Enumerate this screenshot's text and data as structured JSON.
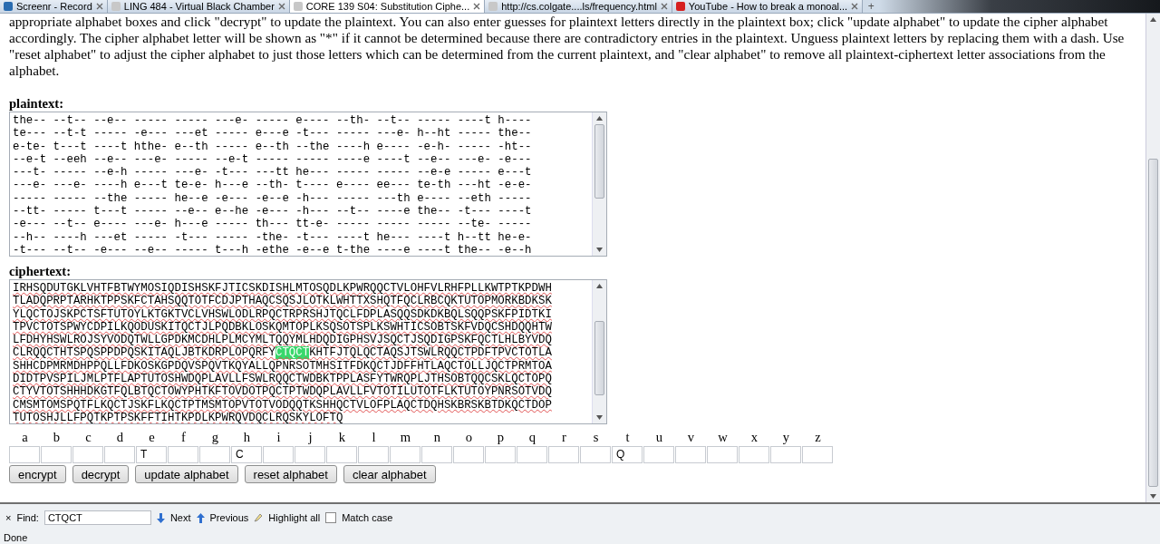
{
  "tabs": [
    {
      "title": "Screenr - Record",
      "selected": false
    },
    {
      "title": "LING 484 - Virtual Black Chamber",
      "selected": false
    },
    {
      "title": "CORE 139 S04: Substitution Ciphe...",
      "selected": true
    },
    {
      "title": "http://cs.colgate....ls/frequency.html",
      "selected": false
    },
    {
      "title": "YouTube - How to break a monoal...",
      "selected": false
    }
  ],
  "new_tab": "+",
  "instructions": "appropriate alphabet boxes and click \"decrypt\" to update the plaintext. You can also enter guesses for plaintext letters directly in the plaintext box; click \"update alphabet\" to update the cipher alphabet accordingly. The cipher alphabet letter will be shown as \"*\" if it cannot be determined because there are contradictory entries in the plaintext. Unguess plaintext letters by replacing them with a dash. Use \"reset alphabet\" to adjust the cipher alphabet to just those letters which can be determined from the current plaintext, and \"clear alphabet\" to remove all plaintext-ciphertext letter associations from the alphabet.",
  "plaintext": {
    "label": "plaintext:",
    "lines": [
      "the-- --t-- --e-- ----- ----- ---e- ----- e---- --th- --t-- ----- ----t h----",
      "te--- --t-t ----- -e--- ---et ----- e---e -t--- ----- ---e- h--ht ----- the--",
      "e-te- t---t ----t hthe- e--th ----- e--th --the ----h e---- -e-h- ----- -ht--",
      "--e-t --eeh --e-- ---e- ----- --e-t ----- ----- ----e ----t --e-- ---e- -e---",
      "---t- ----- --e-h ----- ---e- -t--- ---tt he--- ----- ----- --e-e ----- e---t",
      "---e- ---e- ----h e---t te-e- h---e --th- t---- e---- ee--- te-th ---ht -e-e-",
      "----- ----- --the ----- he--e -e--- -e--e -h--- ----- ---th e---- --eth -----",
      "--tt- ----- t---t ----- --e-- e--he -e--- -h--- --t-- ----e the-- -t--- ----t",
      "-e--- --t-- e---- ---e- h---e ----- th--- tt-e- ----- ----- ----- --te- -----",
      "--h-- ----h ---et ----- -t--- ----- -the- -t--- ----t he--- ----t h--tt he-e-",
      "-t--- --t-- -e--- --e-- ----- t---h -ethe -e--e t-the ----e ----t the-- -e--h"
    ]
  },
  "ciphertext": {
    "label": "ciphertext:",
    "lines": [
      {
        "text": "IRHSQDUTGKLVHTFBTWYMOSIQDISHSKFJTICSKDISHLMTOSQDLKPWRQQCTVLOHFVLRHFPLLKWTPTKPDWH"
      },
      {
        "text": "TLADQPRPTARHKTPPSKFCTAHSQQTOTFCDJPTHAQCSQSJLOTKLWHTTXSHQTFQCLRBCQKTUTOPMORKBDKSK"
      },
      {
        "text": "YLQCTOJSKPCTSFTUTOYLKTGKTVCLVHSWLODLRPQCTRPRSHJTQCLFDPLASQQSDKDKBQLSQQPSKFPIDTKI"
      },
      {
        "text": "TPVCTOTSPWYCDPILKQODUSKITQCTJLPQDBKLOSKQMTOPLKSQSOTSPLKSWHTICSOBTSKFVDQCSHDQQHTW"
      },
      {
        "text": "LFDHYHSWLROJSYVODQTWLLGPDKMCDHLPLMCYMLTQQYMLHDQDIGPHSVJSQCTJSQDIGPSKFQCTLHLBYVDQ"
      },
      {
        "text": "CLRQQCTHTSPQSPPDPQSKITAQLJBTKDRPLOPQRFY",
        "match": "CTQCT",
        "rest": "KHTFJTQLQCTAQSJTSWLRQQCTPDFTPVCTOTLA"
      },
      {
        "text": "SHHCDPMRMDHPPQLLFDKOSKGPDQVSPQVTKQYALLQPNRSOTMHSITFDKQCTJDFFHTLAQCTOLLJQCTPRMTOA"
      },
      {
        "text": "DIDTPVSPILJMLPTFLAPTUTOSHWDQPLAVLLFSWLRQQCTWDBKTPPLASFYTWRQPLJTHSOBTQQCSKLQCTOPQ"
      },
      {
        "text": "CTYVTOTSHHHDKGTFQLBTQCTOWYPHTKFTOVDOTPQCTPTWDQPLAVLLFVTOTILUTOTFLKTUTOYPNRSOTVDQ"
      },
      {
        "text": "CMSMTOMSPQTFLKQCTJSKFLKQCTPTMSMTOPVTOTVODQQTKSHHQCTVLOFPLAQCTDQHSKBRSKBTDKQCTDOP"
      },
      {
        "text": "TUTOSHJLLFPQTKPTPSKFFTIHTKPDLKPWRQVDQCLRQSKYLOFTQ"
      }
    ]
  },
  "alphabet": [
    {
      "letter": "a"
    },
    {
      "letter": "b"
    },
    {
      "letter": "c"
    },
    {
      "letter": "d"
    },
    {
      "letter": "e",
      "value": "T"
    },
    {
      "letter": "f"
    },
    {
      "letter": "g"
    },
    {
      "letter": "h",
      "value": "C"
    },
    {
      "letter": "i"
    },
    {
      "letter": "j"
    },
    {
      "letter": "k"
    },
    {
      "letter": "l"
    },
    {
      "letter": "m"
    },
    {
      "letter": "n"
    },
    {
      "letter": "o"
    },
    {
      "letter": "p"
    },
    {
      "letter": "q"
    },
    {
      "letter": "r"
    },
    {
      "letter": "s"
    },
    {
      "letter": "t",
      "value": "Q"
    },
    {
      "letter": "u"
    },
    {
      "letter": "v"
    },
    {
      "letter": "w"
    },
    {
      "letter": "x"
    },
    {
      "letter": "y"
    },
    {
      "letter": "z"
    }
  ],
  "buttons": [
    "encrypt",
    "decrypt",
    "update alphabet",
    "reset alphabet",
    "clear alphabet"
  ],
  "find_bar": {
    "close": "×",
    "label": "Find:",
    "value": "CTQCT",
    "next": "Next",
    "previous": "Previous",
    "highlight_all": "Highlight all",
    "match_case": {
      "label": "Match case",
      "checked": false
    }
  },
  "status_bar": "Done"
}
